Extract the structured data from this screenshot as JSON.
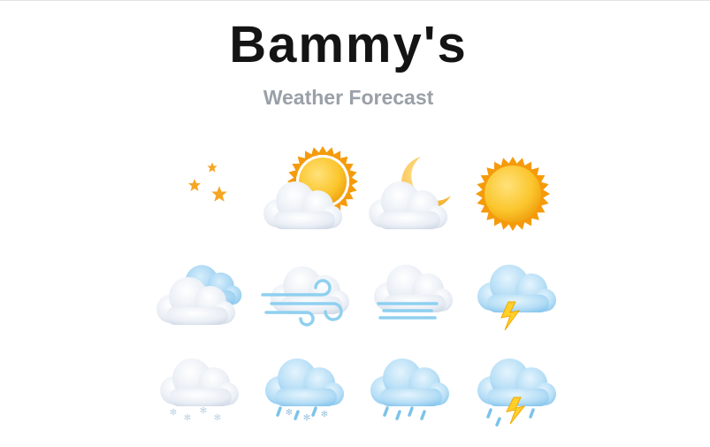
{
  "header": {
    "title": "Bammy's",
    "subtitle": "Weather Forecast"
  },
  "icons": [
    "clear-night-icon",
    "partly-cloudy-day-icon",
    "partly-cloudy-night-icon",
    "clear-day-icon",
    "cloudy-icon",
    "windy-icon",
    "fog-icon",
    "thunderstorm-icon",
    "snow-icon",
    "sleet-icon",
    "rain-icon",
    "thunder-rain-icon"
  ],
  "colors": {
    "title": "#141414",
    "subtitle": "#9aa0a8",
    "sun": "#fbc52c",
    "sun_rays": "#f59b0b",
    "moon": "#fbc64a",
    "cloud_white": "#eef3f8",
    "cloud_blue": "#a9d8f5",
    "bolt": "#ffd02a",
    "rain": "#7cc3ea"
  }
}
